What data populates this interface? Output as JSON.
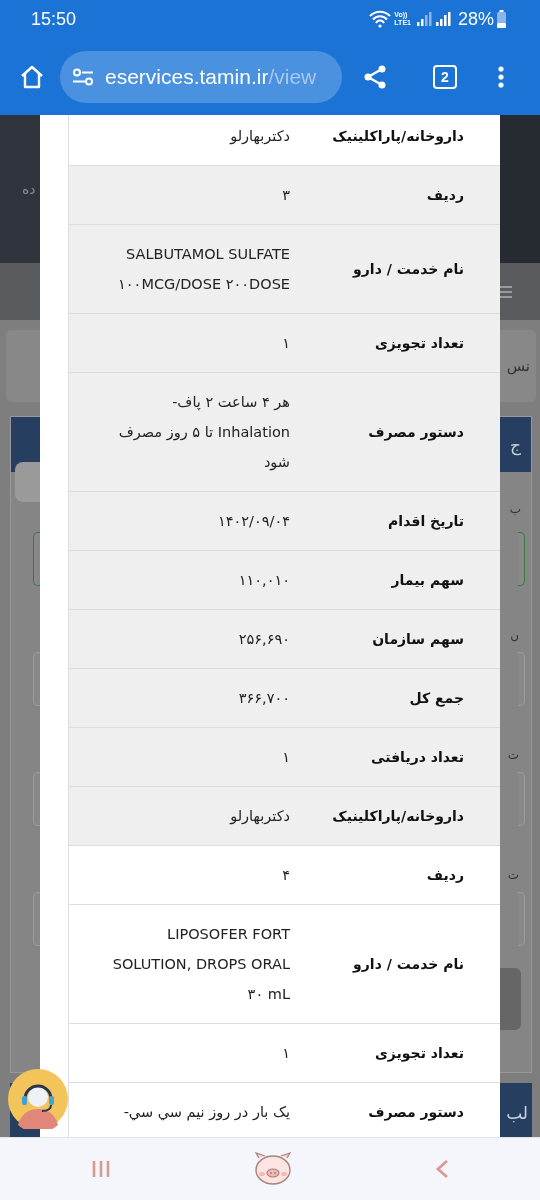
{
  "status_bar": {
    "time": "15:50",
    "volte": "Vo))",
    "lte": "LTE1",
    "battery": "28%"
  },
  "browser": {
    "url_host": "eservices.tamin.ir",
    "url_path": "/view",
    "tab_count": "2"
  },
  "background": {
    "header_fragment": "ده",
    "side_fragments": [
      "نس",
      "ج",
      "ب",
      "ن",
      "ت",
      "ت",
      "لب"
    ]
  },
  "records": [
    {
      "rows": [
        {
          "label": "داروخانه/پاراکلینیک",
          "value": "دکتربهارلو"
        }
      ]
    },
    {
      "rows": [
        {
          "label": "ردیف",
          "value": "۳"
        },
        {
          "label": "نام خدمت / دارو",
          "value": "SALBUTAMOL SULFATE ۱۰۰MCG/DOSE ۲۰۰DOSE"
        },
        {
          "label": "تعداد تجویزی",
          "value": "۱"
        },
        {
          "label": "دستور مصرف",
          "value": "هر ۴ ساعت ۲ پاف- Inhalation تا ۵ روز مصرف شود"
        },
        {
          "label": "تاریخ اقدام",
          "value": "۱۴۰۲/۰۹/۰۴"
        },
        {
          "label": "سهم بیمار",
          "value": "۱۱۰,۰۱۰"
        },
        {
          "label": "سهم سازمان",
          "value": "۲۵۶,۶۹۰"
        },
        {
          "label": "جمع کل",
          "value": "۳۶۶,۷۰۰"
        },
        {
          "label": "تعداد دریافتی",
          "value": "۱"
        },
        {
          "label": "داروخانه/پاراکلینیک",
          "value": "دکتربهارلو"
        }
      ]
    },
    {
      "rows": [
        {
          "label": "ردیف",
          "value": "۴"
        },
        {
          "label": "نام خدمت / دارو",
          "value": "LIPOSOFER FORT SOLUTION, DROPS ORAL ۳۰ mL"
        },
        {
          "label": "تعداد تجویزی",
          "value": "۱"
        },
        {
          "label": "دستور مصرف",
          "value": "یک بار در روز نیم سي سي-"
        }
      ]
    }
  ]
}
